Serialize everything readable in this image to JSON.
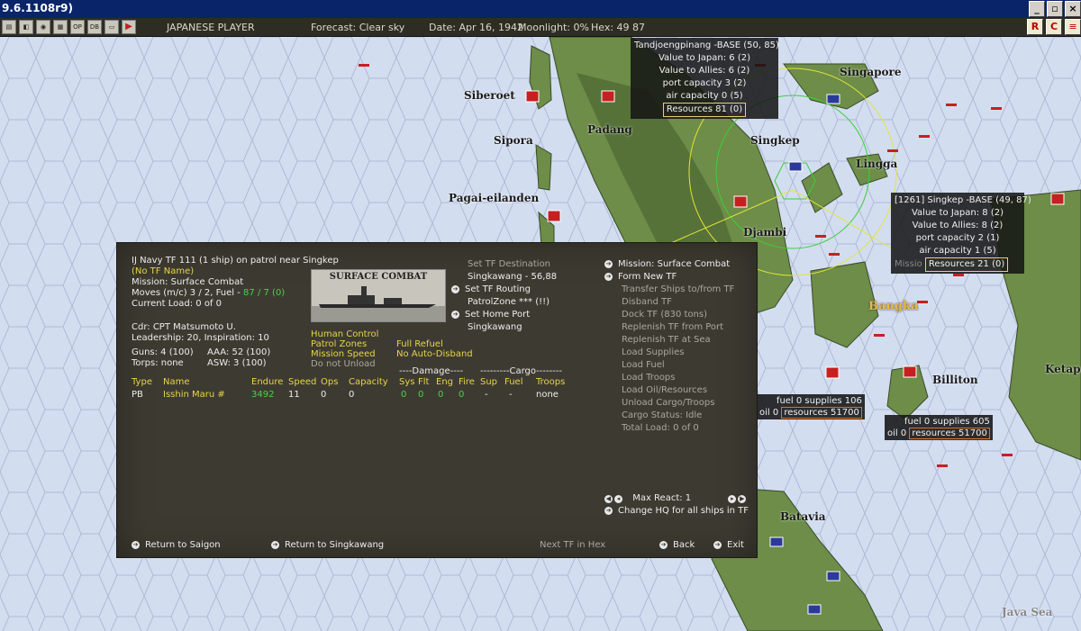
{
  "window": {
    "title": "9.6.1108r9)"
  },
  "toolbar": {
    "player": "JAPANESE PLAYER",
    "forecast": "Forecast: Clear sky",
    "date": "Date: Apr 16, 1942",
    "moonlight": "Moonlight: 0%",
    "hex": "Hex: 49 87"
  },
  "map": {
    "places": [
      "Singapore",
      "Siberoet",
      "Padang",
      "Sipora",
      "Singkep",
      "Lingga",
      "Pagai-eilanden",
      "Djambi",
      "Bangka",
      "Billiton",
      "Ketapa",
      "Batavia",
      "Java Sea"
    ],
    "base_tooltips": [
      {
        "title": "Tandjoengpinang -BASE (50, 85)",
        "lines": [
          "Value to Japan: 6 (2)",
          "Value to Allies: 6 (2)",
          "port capacity 3 (2)",
          "air capacity 0 (5)"
        ],
        "resources": "Resources 81 (0)"
      },
      {
        "title": "[1261] Singkep -BASE (49, 87)",
        "lines": [
          "Value to Japan: 8 (2)",
          "Value to Allies: 8 (2)",
          "port capacity 2 (1)",
          "air capacity 1 (5)"
        ],
        "resources": "Resources 21 (0)",
        "partial": "Missio"
      }
    ],
    "supply_boxes": [
      {
        "line1": "fuel 0  supplies 106",
        "oil": "oil 0",
        "resources": "resources 51700"
      },
      {
        "line1": "fuel 0  supplies 605",
        "oil": "oil 0",
        "resources": "resources 51700"
      }
    ]
  },
  "tf_panel": {
    "header": "IJ Navy TF 111 (1 ship)  on patrol near Singkep",
    "tf_name": "(No TF Name)",
    "mission": "Mission: Surface Combat",
    "moves_label": "Moves (m/c)  3 / 2, Fuel - ",
    "moves_fuel": "87 / 7 (0)",
    "current_load": "Current Load:  0 of 0",
    "commander": "Cdr: CPT  Matsumoto U.",
    "leadership": "Leadership: 20, Inspiration: 10",
    "guns": "Guns: 4 (100)",
    "aaa": "AAA: 52 (100)",
    "torps": "Torps: none",
    "asw": "ASW: 3 (100)",
    "photo_caption": "SURFACE COMBAT",
    "options": {
      "human_control": "Human Control",
      "patrol_zones": "Patrol Zones",
      "mission_speed": "Mission Speed",
      "do_not_unload": "Do not Unload",
      "full_refuel": "Full Refuel",
      "no_auto_disband": "No Auto-Disband"
    },
    "destination": {
      "set_dest": "Set TF Destination",
      "dest_value": "Singkawang - 56,88",
      "set_routing": "Set TF Routing",
      "patrol_zone": "PatrolZone  *** (!!)",
      "set_home": "Set Home Port",
      "home_value": "Singkawang"
    },
    "commands": [
      "Mission: Surface Combat",
      "Form New TF",
      "Transfer Ships to/from TF",
      "Disband TF",
      "Dock TF  (830 tons)",
      "Replenish TF from Port",
      "Replenish TF at Sea",
      "Load Supplies",
      "Load Fuel",
      "Load Troops",
      "Load Oil/Resources",
      "Unload Cargo/Troops",
      "Cargo Status: Idle",
      "Total Load: 0 of 0"
    ],
    "max_react": "Max React:  1",
    "change_hq": "Change HQ for all ships in TF",
    "table": {
      "damage_header": "----Damage----",
      "cargo_header": "---------Cargo--------",
      "headers": {
        "type": "Type",
        "name": "Name",
        "endure": "Endure",
        "speed": "Speed",
        "ops": "Ops",
        "capacity": "Capacity",
        "sys": "Sys",
        "flt": "Flt",
        "eng": "Eng",
        "fire": "Fire",
        "sup": "Sup",
        "fuel": "Fuel",
        "troops": "Troops"
      },
      "rows": [
        {
          "type": "PB",
          "name": "Isshin Maru #",
          "endure": "3492",
          "speed": "11",
          "ops": "0",
          "capacity": "0",
          "sys": "0",
          "flt": "0",
          "eng": "0",
          "fire": "0",
          "sup": "-",
          "fuel": "-",
          "troops": "none"
        }
      ]
    },
    "footer": {
      "return_saigon": "Return to Saigon",
      "return_singkawang": "Return to Singkawang",
      "next_tf": "Next TF in Hex",
      "back": "Back",
      "exit": "Exit"
    }
  }
}
